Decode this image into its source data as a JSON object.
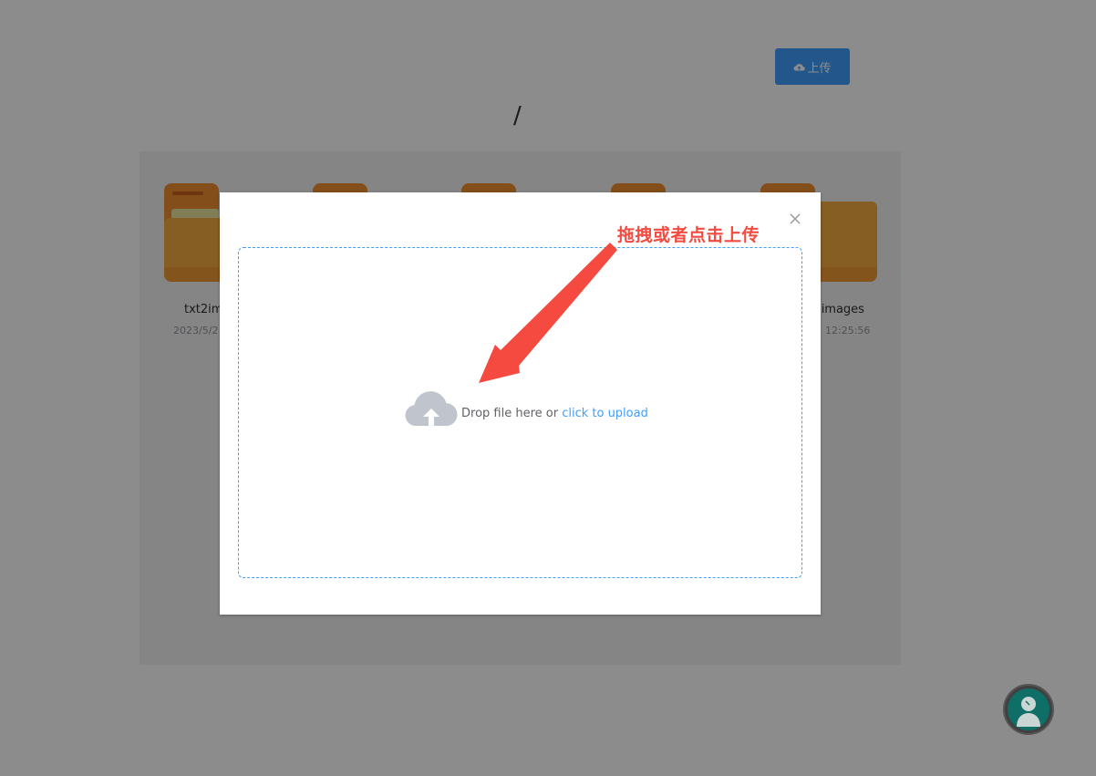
{
  "toolbar": {
    "upload_label": "上传",
    "upload_icon": "cloud-upload-icon"
  },
  "breadcrumb": {
    "path": "/"
  },
  "files": [
    {
      "name": "txt2im",
      "date": "2023/5/2"
    },
    {
      "name": "-images",
      "date": "12:25:56"
    }
  ],
  "upload_dialog": {
    "close_icon": "close-icon",
    "dropzone": {
      "icon": "cloud-upload-icon",
      "text": "Drop file here or ",
      "link": "click to upload"
    }
  },
  "annotation": {
    "label": "拖拽或者点击上传",
    "color": "#f44a3f"
  },
  "colors": {
    "primary": "#409eff",
    "folder": "#f5a93e",
    "overlay": "rgba(0,0,0,0.45)"
  }
}
